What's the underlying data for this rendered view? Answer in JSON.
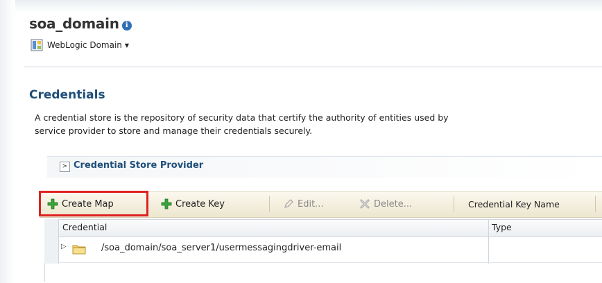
{
  "header": {
    "title": "soa_domain",
    "info_glyph": "i",
    "domain_menu_label": "WebLogic Domain"
  },
  "credentials": {
    "title": "Credentials",
    "description_line1": "A credential store is the repository of security data that certify the authority of entities used by",
    "description_line2": "service provider to store and manage their credentials securely.",
    "provider_section_label": "Credential Store Provider"
  },
  "toolbar": {
    "create_map": "Create Map",
    "create_key": "Create Key",
    "edit": "Edit...",
    "delete": "Delete...",
    "key_name": "Credential Key Name"
  },
  "table": {
    "columns": [
      "Credential",
      "Type"
    ],
    "rows": [
      {
        "credential": "/soa_domain/soa_server1/usermessagingdriver-email",
        "type": ""
      }
    ]
  },
  "colors": {
    "section_title": "#1f4e79",
    "highlight": "#e02020",
    "toolbar_bg": "#ede6cf",
    "plus_green": "#3aa63a"
  },
  "icons": [
    "info-icon",
    "weblogic-domain-icon",
    "chevron-down-icon",
    "expand-icon",
    "plus-icon",
    "pencil-icon",
    "delete-x-icon",
    "tree-expand-icon",
    "folder-icon"
  ]
}
